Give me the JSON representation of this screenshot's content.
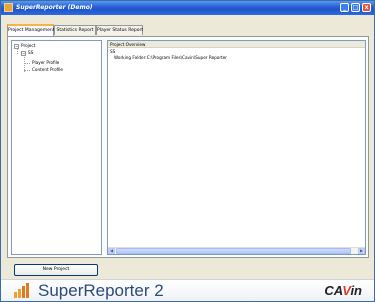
{
  "window": {
    "title": "SuperReporter (Demo)"
  },
  "tabs": [
    {
      "label": "Project Management",
      "active": true
    },
    {
      "label": "Statistics Report",
      "active": false
    },
    {
      "label": "Player Status Report",
      "active": false
    }
  ],
  "tree": {
    "root": "Project",
    "child": "SS",
    "leaves": [
      "Player Profile",
      "Content Profile"
    ]
  },
  "overview": {
    "header": "Project Overview",
    "project_name": "SS",
    "working_folder_label": "Working Folder:",
    "working_folder_value": "C:\\Program Files\\Cavin\\Super Reporter"
  },
  "buttons": {
    "new_project": "New Project"
  },
  "footer": {
    "brand": "SuperReporter 2",
    "company_prefix": "CA",
    "company_accent": "V",
    "company_suffix": "in"
  },
  "colors": {
    "titlebar": "#2a62d6",
    "tab_accent": "#f5b54c",
    "brand_text": "#2c4a7a",
    "company_accent": "#d63a2c"
  }
}
